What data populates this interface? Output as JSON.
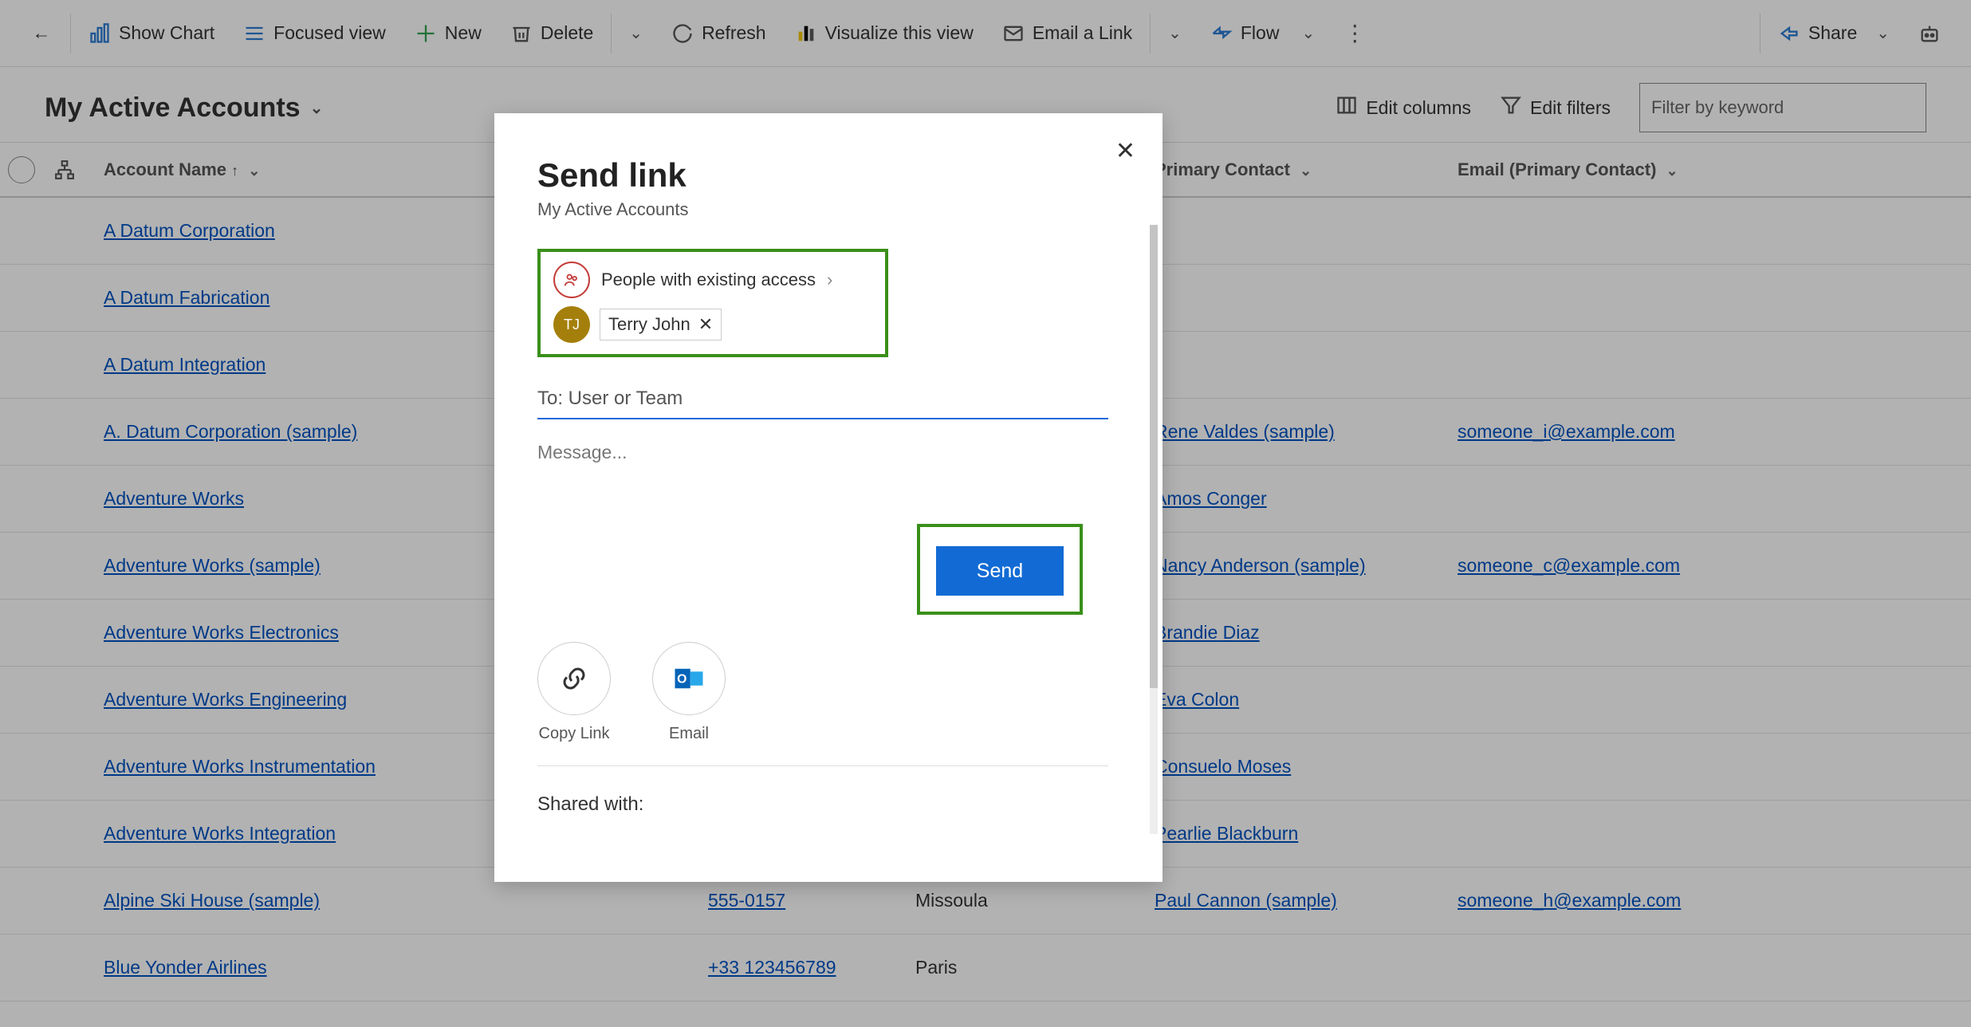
{
  "toolbar": {
    "show_chart": "Show Chart",
    "focused_view": "Focused view",
    "new": "New",
    "delete": "Delete",
    "refresh": "Refresh",
    "visualize": "Visualize this view",
    "email_link": "Email a Link",
    "flow": "Flow",
    "share": "Share"
  },
  "view": {
    "name": "My Active Accounts",
    "edit_columns": "Edit columns",
    "edit_filters": "Edit filters",
    "filter_placeholder": "Filter by keyword"
  },
  "columns": {
    "name": "Account Name",
    "phone": "",
    "city": "",
    "contact": "Primary Contact",
    "email": "Email (Primary Contact)"
  },
  "rows": [
    {
      "name": "A Datum Corporation",
      "phone": "",
      "city": "",
      "contact": "",
      "email": ""
    },
    {
      "name": "A Datum Fabrication",
      "phone": "",
      "city": "",
      "contact": "",
      "email": ""
    },
    {
      "name": "A Datum Integration",
      "phone": "",
      "city": "",
      "contact": "",
      "email": ""
    },
    {
      "name": "A. Datum Corporation (sample)",
      "phone": "",
      "city": "",
      "contact": "Rene Valdes (sample)",
      "email": "someone_i@example.com"
    },
    {
      "name": "Adventure Works",
      "phone": "",
      "city": "",
      "contact": "Amos Conger",
      "email": ""
    },
    {
      "name": "Adventure Works (sample)",
      "phone": "",
      "city": "",
      "contact": "Nancy Anderson (sample)",
      "email": "someone_c@example.com"
    },
    {
      "name": "Adventure Works Electronics",
      "phone": "",
      "city": "",
      "contact": "Brandie Diaz",
      "email": ""
    },
    {
      "name": "Adventure Works Engineering",
      "phone": "",
      "city": "",
      "contact": "Eva Colon",
      "email": ""
    },
    {
      "name": "Adventure Works Instrumentation",
      "phone": "",
      "city": "",
      "contact": "Consuelo Moses",
      "email": ""
    },
    {
      "name": "Adventure Works Integration",
      "phone": "",
      "city": "",
      "contact": "Pearlie Blackburn",
      "email": ""
    },
    {
      "name": "Alpine Ski House (sample)",
      "phone": "555-0157",
      "city": "Missoula",
      "contact": "Paul Cannon (sample)",
      "email": "someone_h@example.com"
    },
    {
      "name": "Blue Yonder Airlines",
      "phone": "+33 123456789",
      "city": "Paris",
      "contact": "",
      "email": ""
    }
  ],
  "modal": {
    "title": "Send link",
    "subtitle": "My Active Accounts",
    "access_label": "People with existing access",
    "selected_user": "Terry John",
    "selected_initials": "TJ",
    "to_placeholder": "To: User or Team",
    "message_placeholder": "Message...",
    "send": "Send",
    "copy_link": "Copy Link",
    "email": "Email",
    "shared_with": "Shared with:"
  }
}
